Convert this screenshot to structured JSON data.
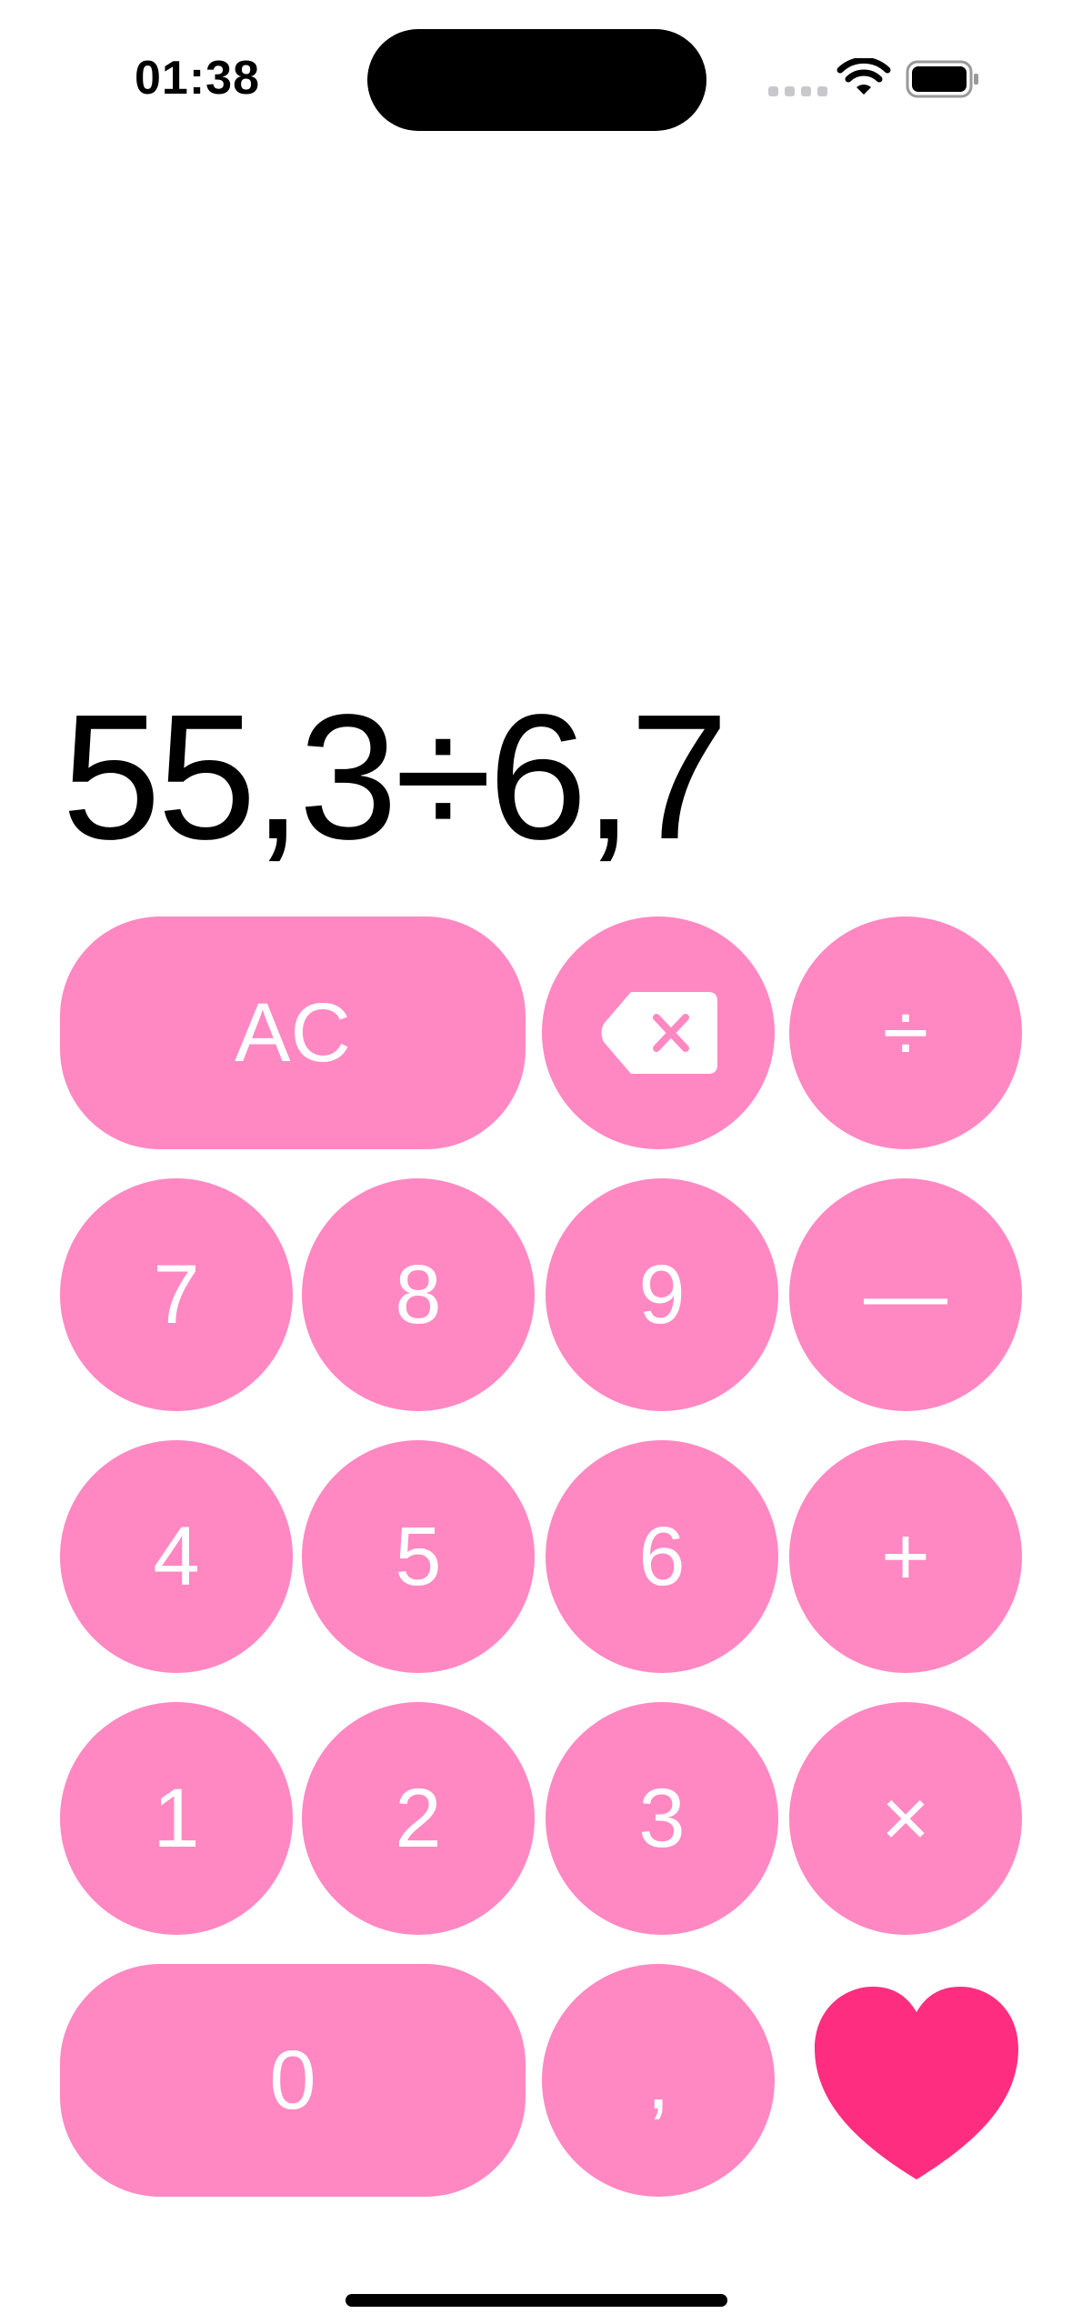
{
  "status_bar": {
    "time": "01:38",
    "icons": [
      "cellular-signal-icon",
      "wifi-icon",
      "battery-icon"
    ]
  },
  "display": {
    "expression": "55,3÷6,7"
  },
  "keypad": {
    "clear": "AC",
    "backspace_icon": "backspace-icon",
    "divide": "÷",
    "subtract": "—",
    "add": "+",
    "multiply": "×",
    "digits": {
      "seven": "7",
      "eight": "8",
      "nine": "9",
      "four": "4",
      "five": "5",
      "six": "6",
      "one": "1",
      "two": "2",
      "three": "3",
      "zero": "0"
    },
    "decimal": ",",
    "heart_icon": "heart-icon"
  },
  "colors": {
    "key_background": "#ff88c2",
    "key_text": "#ffffff",
    "heart": "#ff2d7f",
    "display_text": "#000000",
    "background": "#ffffff"
  }
}
